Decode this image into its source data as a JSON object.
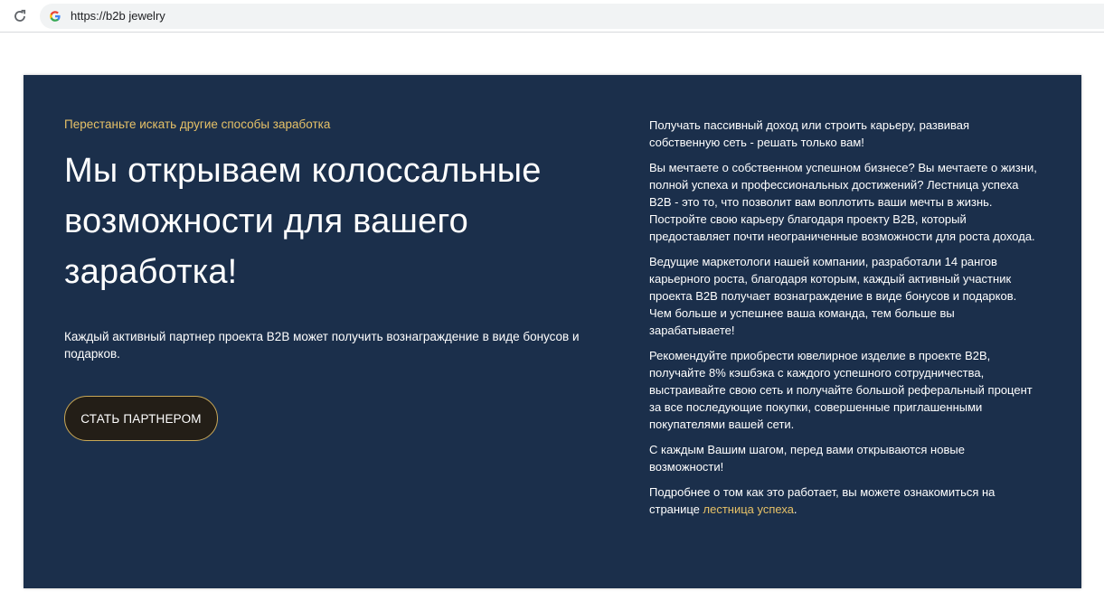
{
  "browser": {
    "url": "https://b2b jewelry"
  },
  "colors": {
    "card_bg": "#1b2f4b",
    "accent_gold": "#e6c167",
    "button_bg": "#231e17",
    "button_border": "#c9a857"
  },
  "hero": {
    "eyebrow": "Перестаньте искать другие способы заработка",
    "headline": "Мы открываем колоссальные возможности для вашего заработка!",
    "lead": "Каждый активный партнер проекта В2В может получить вознаграждение в виде бонусов и подарков.",
    "cta_label": "СТАТЬ ПАРТНЕРОМ"
  },
  "details": {
    "p1": "Получать пассивный доход или строить карьеру, развивая собственную сеть - решать только вам!",
    "p2": "Вы мечтаете о собственном успешном бизнесе? Вы мечтаете о жизни, полной успеха и профессиональных достижений? Лестница успеха B2B - это то, что позволит вам воплотить ваши мечты в жизнь. Постройте свою карьеру благодаря проекту B2B, который предоставляет почти неограниченные возможности для роста дохода.",
    "p3": "Ведущие маркетологи нашей компании, разработали 14 рангов карьерного роста, благодаря которым, каждый активный участник проекта B2B получает вознаграждение в виде бонусов и подарков. Чем больше и успешнее ваша команда, тем больше вы зарабатываете!",
    "p4": "Рекомендуйте приобрести ювелирное изделие в проекте В2В, получайте 8% кэшбэка с каждого успешного сотрудничества, выстраивайте свою сеть и получайте большой реферальный процент за все последующие покупки, совершенные приглашенными покупателями вашей сети.",
    "p5": "С каждым Вашим шагом, перед вами открываются новые возможности!",
    "p6_before": "Подробнее о том как это работает, вы можете ознакомиться на странице ",
    "p6_link": "лестница успеха",
    "p6_after": "."
  }
}
